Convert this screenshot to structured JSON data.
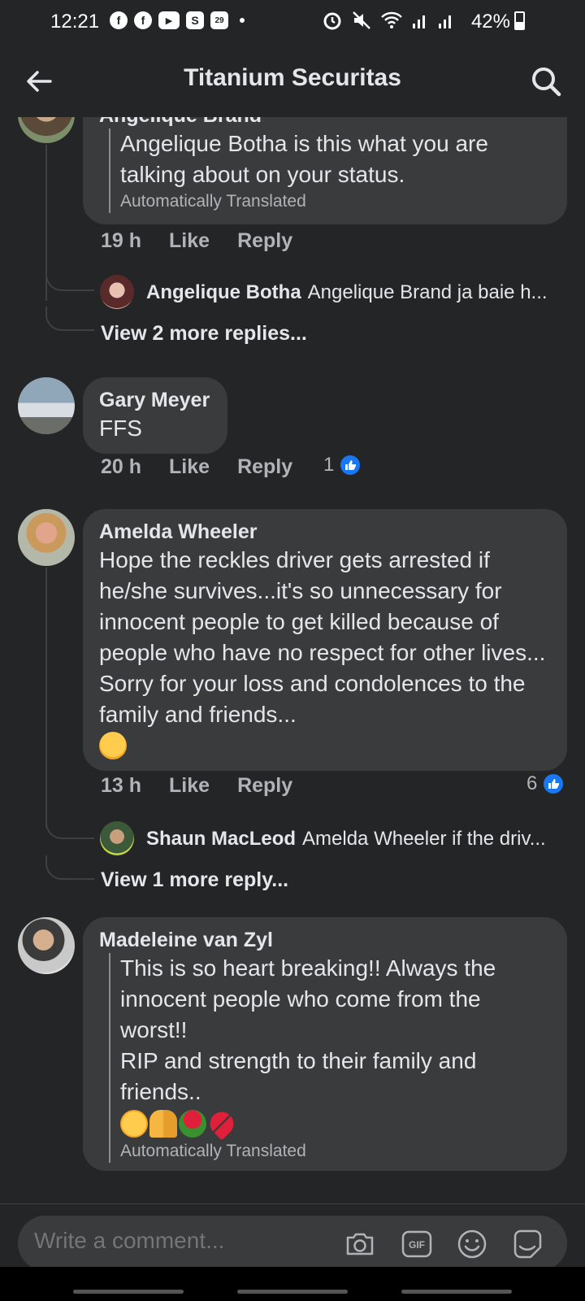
{
  "status": {
    "time": "12:21",
    "battery": "42%",
    "notif_badge": "29",
    "s_badge": "S"
  },
  "header": {
    "title": "Titanium Securitas"
  },
  "comments": [
    {
      "name": "Angelique Brand",
      "text": "Angelique Botha is this what you are talking about on your status.",
      "translated": "Automatically Translated",
      "time": "19 h",
      "like": "Like",
      "reply": "Reply",
      "replies_preview": {
        "name": "Angelique Botha",
        "text": "Angelique Brand ja baie h..."
      },
      "view_more": "View 2 more replies..."
    },
    {
      "name": "Gary Meyer",
      "text": "FFS",
      "time": "20 h",
      "like": "Like",
      "reply": "Reply",
      "like_count": "1"
    },
    {
      "name": "Amelda Wheeler",
      "text": "Hope the reckles driver gets arrested if he/she survives...it's so unnecessary for innocent people to get killed because of people who have no respect for other lives... Sorry for your loss and condolences to the family and friends...",
      "emoji": "crying-face",
      "time": "13 h",
      "like": "Like",
      "reply": "Reply",
      "like_count": "6",
      "replies_preview": {
        "name": "Shaun MacLeod",
        "text": "Amelda Wheeler if the driv..."
      },
      "view_more": "View 1 more reply..."
    },
    {
      "name": "Madeleine van Zyl",
      "text_lines": [
        "This is so heart breaking!! Always the innocent people who come from the worst!!",
        "RIP and strength to their family and friends.."
      ],
      "emojis": [
        "sad-face",
        "praying-hands",
        "rose",
        "broken-heart"
      ],
      "translated": "Automatically Translated"
    }
  ],
  "composer": {
    "placeholder": "Write a comment..."
  },
  "colors": {
    "background": "#242526",
    "bubble": "#3a3b3c",
    "like_blue": "#1877f2"
  }
}
